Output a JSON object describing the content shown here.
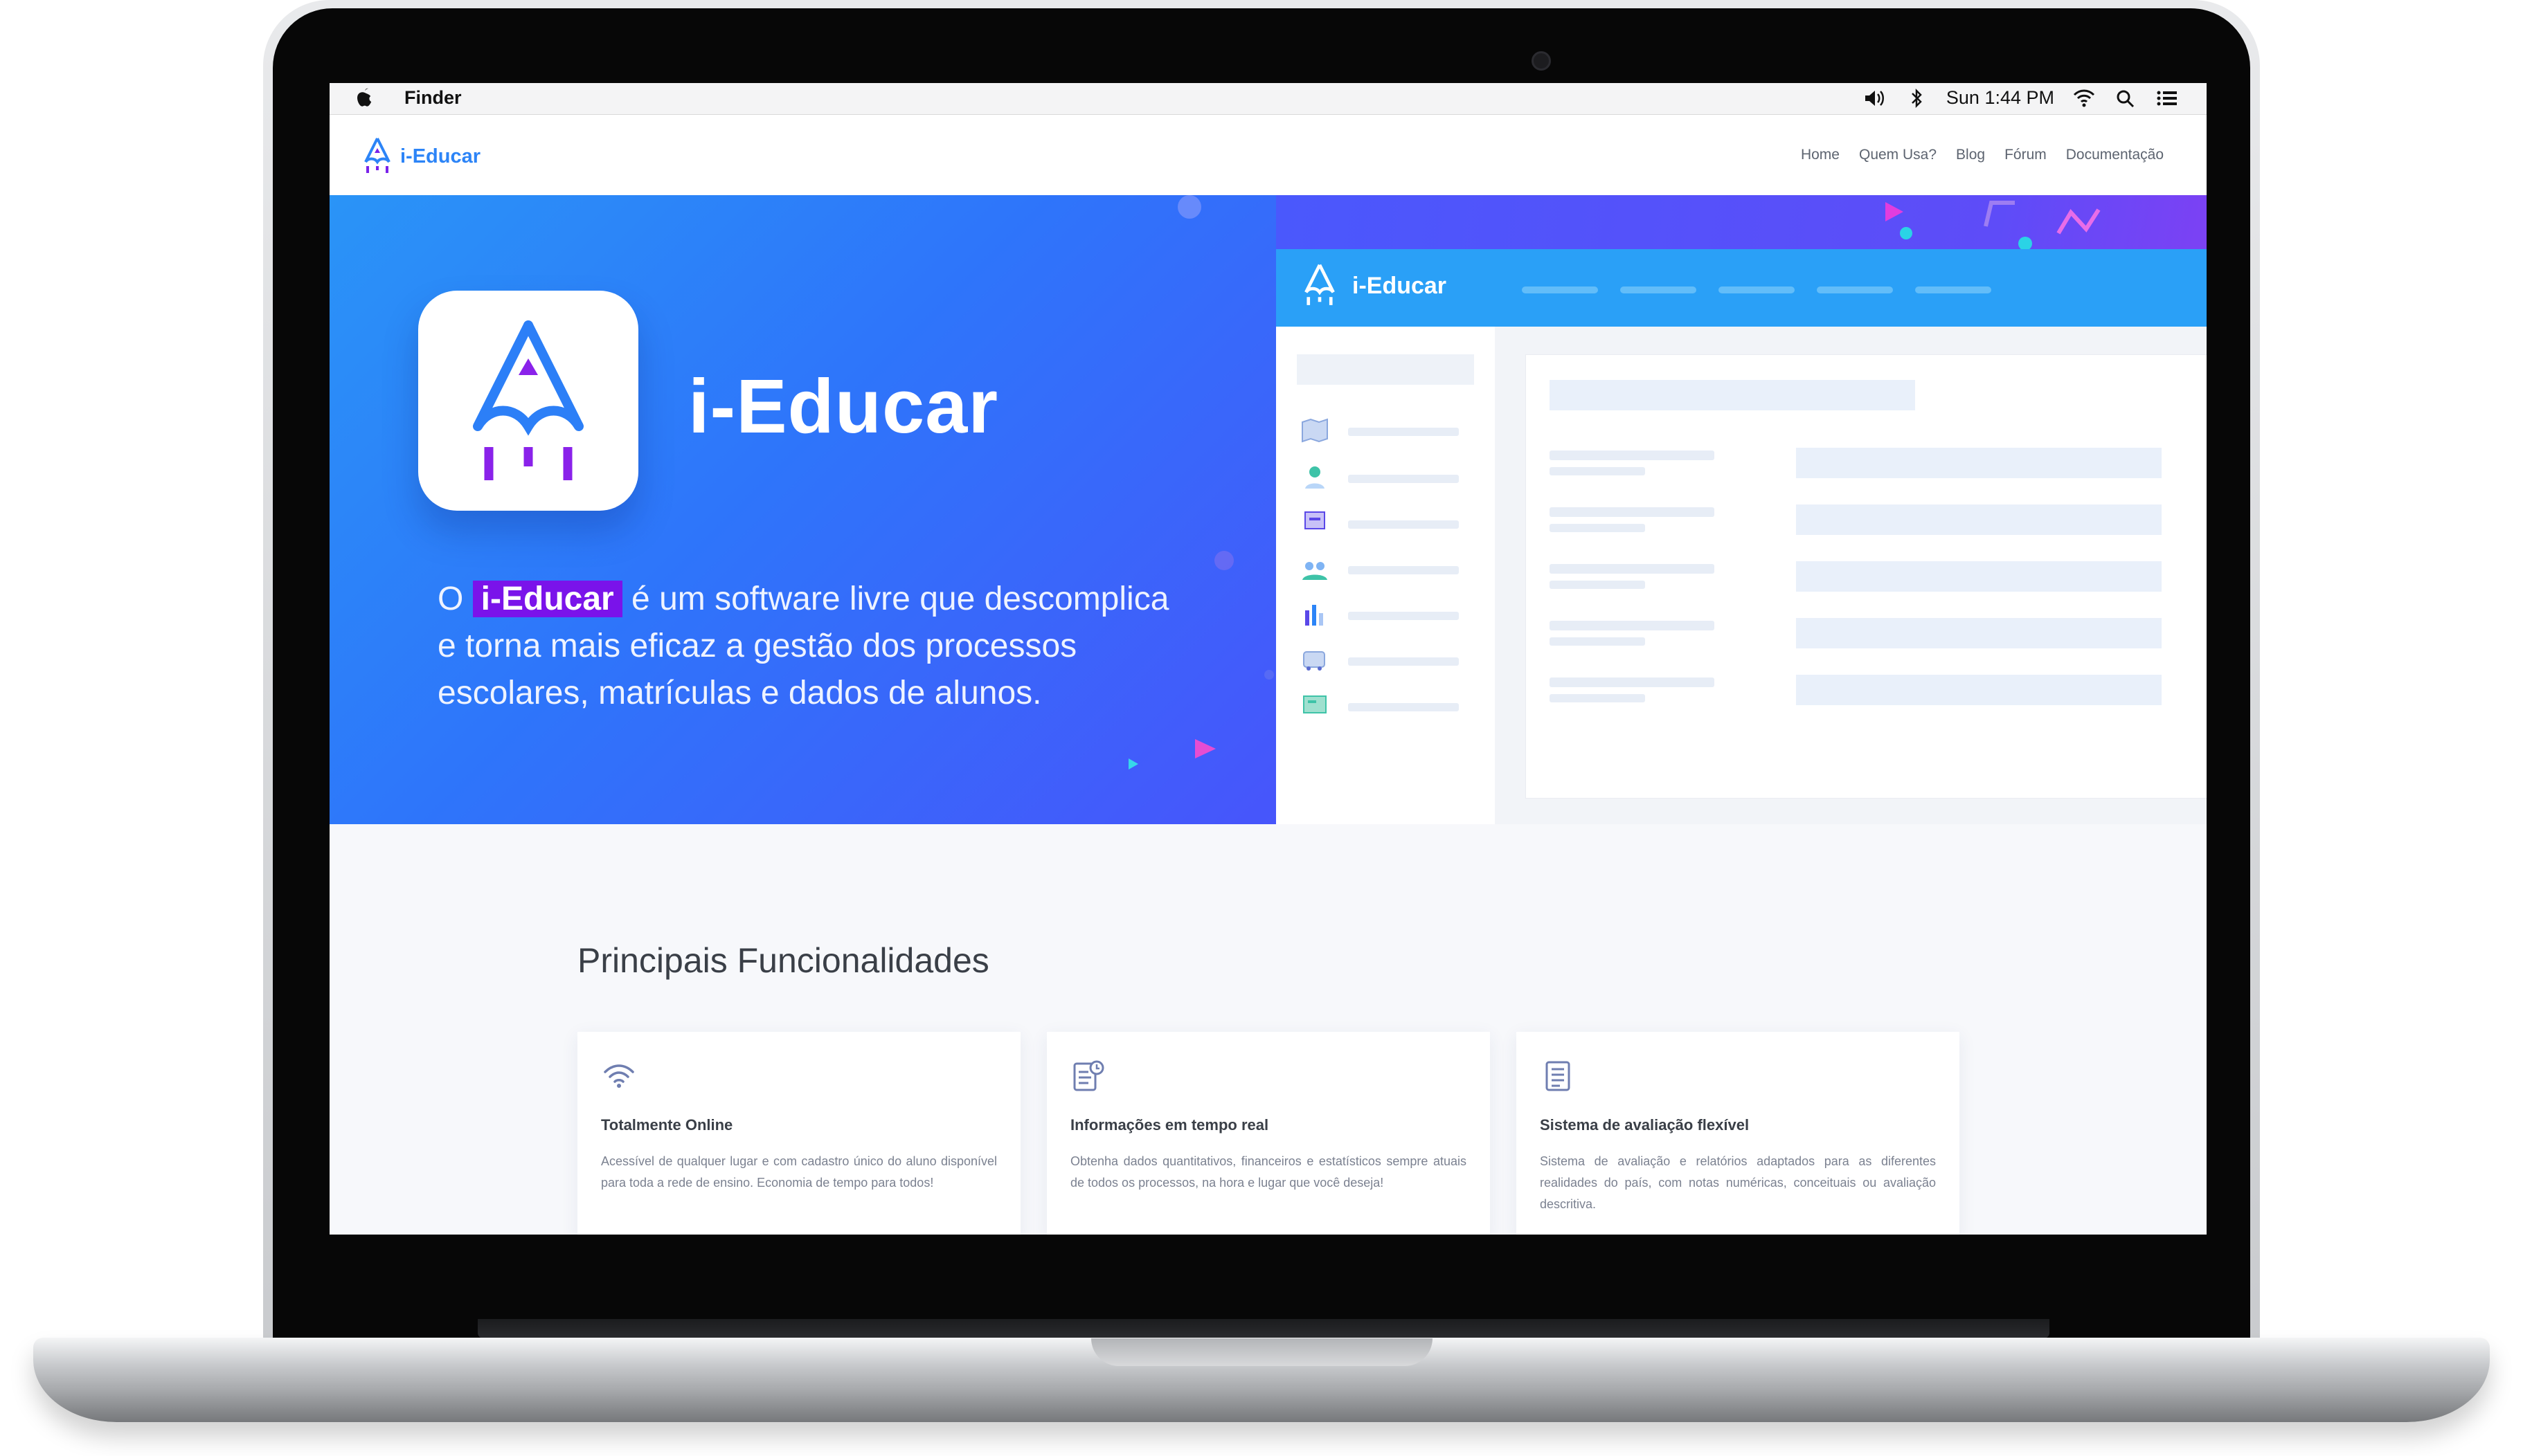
{
  "menubar": {
    "app_name": "Finder",
    "clock": "Sun 1:44 PM"
  },
  "nav": {
    "logo_text": "i-Educar",
    "links": [
      "Home",
      "Quem Usa?",
      "Blog",
      "Fórum",
      "Documentação"
    ]
  },
  "hero": {
    "title": "i-Educar",
    "text_before": "O ",
    "highlight": "i-Educar",
    "text_after": " é um software livre que descomplica e torna mais eficaz a gestão dos processos escolares, matrículas e dados de alunos."
  },
  "mock_window": {
    "logo_text": "i-Educar"
  },
  "features": {
    "title": "Principais Funcionalidades",
    "cards": [
      {
        "icon": "wifi-icon",
        "title": "Totalmente Online",
        "description": "Acessível de qualquer lugar e com cadastro único do aluno disponível para toda a rede de ensino. Economia de tempo para todos!"
      },
      {
        "icon": "report-clock-icon",
        "title": "Informações em tempo real",
        "description": "Obtenha dados quantitativos, financeiros e estatísticos sempre atuais de todos os processos, na hora e lugar que você deseja!"
      },
      {
        "icon": "document-icon",
        "title": "Sistema de avaliação flexível",
        "description": "Sistema de avaliação e relatórios adaptados para as diferentes realidades do país, com notas numéricas, conceituais ou avaliação descritiva."
      }
    ]
  },
  "colors": {
    "brand_blue": "#2c84f7",
    "highlight_purple": "#7a13ea",
    "icon_purple": "#7a22ea"
  }
}
